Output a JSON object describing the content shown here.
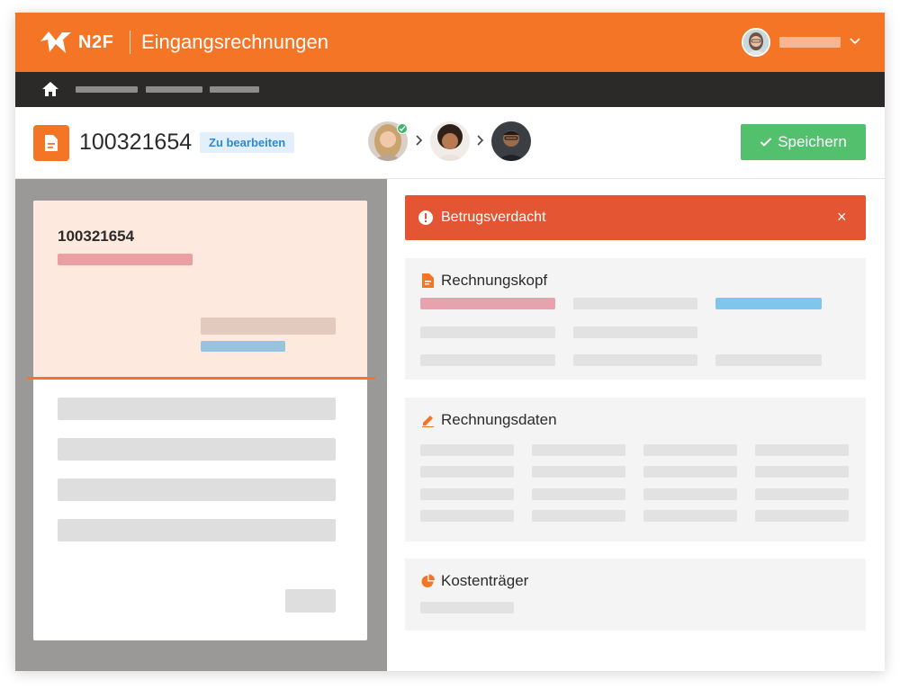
{
  "topbar": {
    "brand": "N2F",
    "title": "Eingangsrechnungen",
    "color": "#f47526"
  },
  "navbar": {
    "color": "#2c2a29"
  },
  "header": {
    "document_number": "100321654",
    "status": "Zu bearbeiten",
    "save_label": "Speichern"
  },
  "preview": {
    "document_number": "100321654"
  },
  "alert": {
    "text": "Betrugsverdacht",
    "close": "×",
    "color": "#e35533"
  },
  "sections": {
    "header_section": {
      "title": "Rechnungskopf",
      "icon": "document-icon"
    },
    "data_section": {
      "title": "Rechnungsdaten",
      "icon": "pencil-icon"
    },
    "cost_section": {
      "title": "Kostenträger",
      "icon": "pie-chart-icon"
    }
  },
  "colors": {
    "accent": "#f47526",
    "success": "#53c06e",
    "alert": "#e35533",
    "badge_text": "#2a8ad3"
  }
}
